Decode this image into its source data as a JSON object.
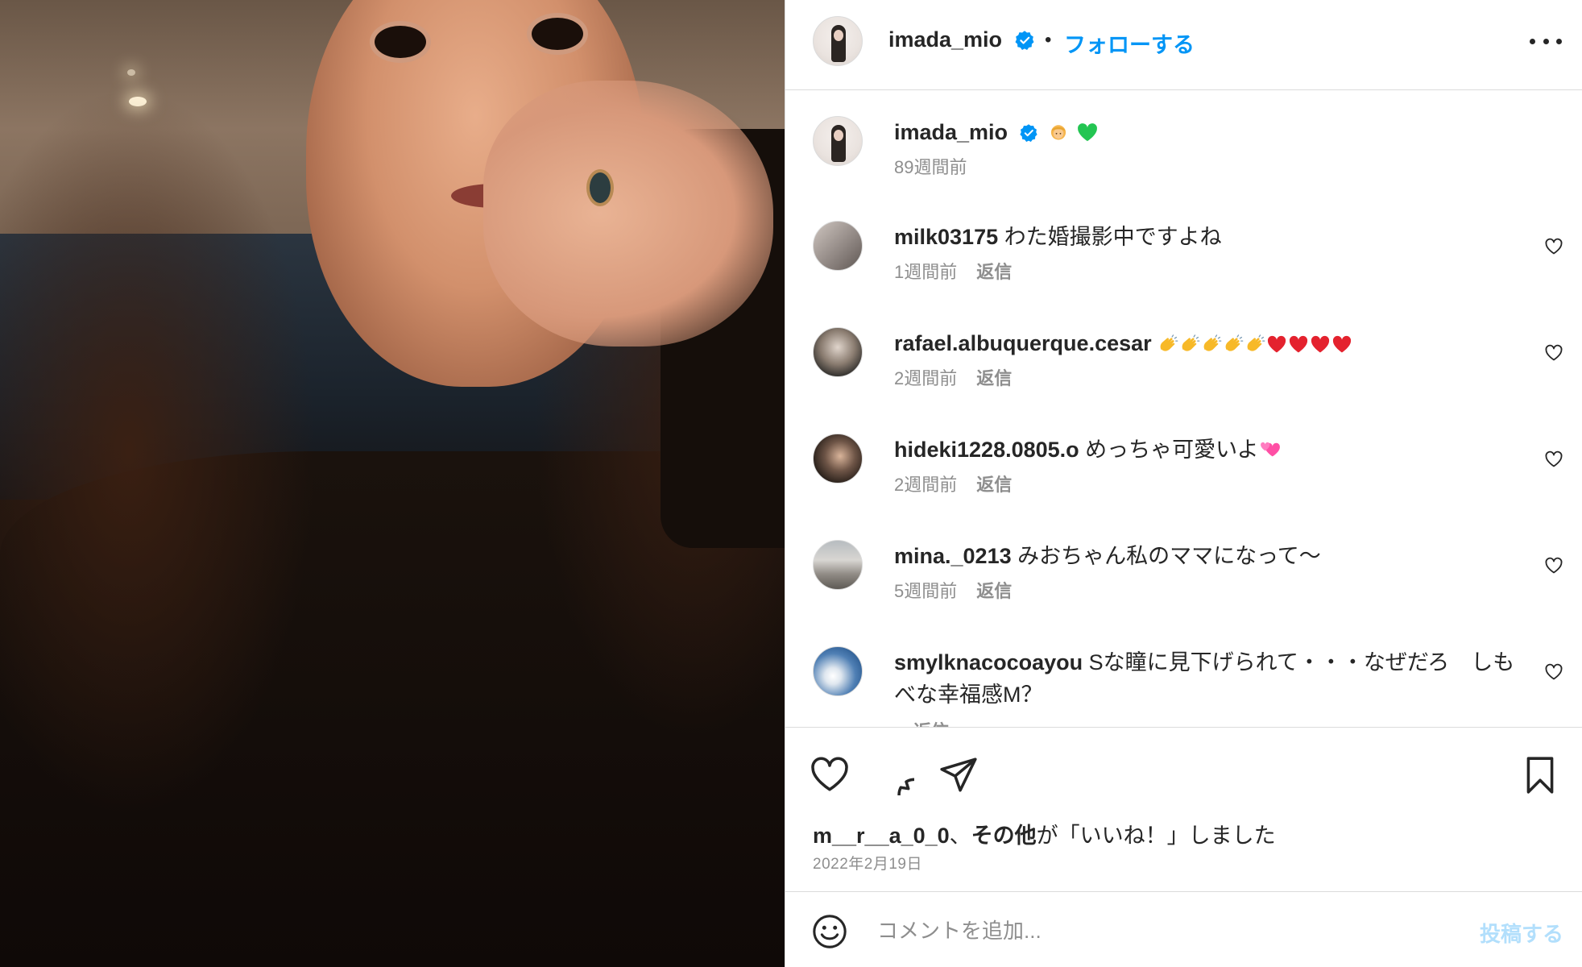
{
  "post": {
    "owner_username": "imada_mio",
    "follow_label": "フォローする",
    "separator": "•",
    "caption_emoji": [
      "person-blond-emoji",
      "green-heart-emoji"
    ],
    "caption_time": "89週間前"
  },
  "comments": [
    {
      "username": "milk03175",
      "text": "わた婚撮影中ですよね",
      "time": "1週間前",
      "reply_label": "返信"
    },
    {
      "username": "rafael.albuquerque.cesar",
      "text": "",
      "emoji": [
        "clapping-hands",
        "clapping-hands",
        "clapping-hands",
        "clapping-hands",
        "clapping-hands",
        "red-heart",
        "red-heart",
        "red-heart",
        "red-heart"
      ],
      "time": "2週間前",
      "reply_label": "返信"
    },
    {
      "username": "hideki1228.0805.o",
      "text": "めっちゃ可愛いよ",
      "emoji": [
        "two-hearts"
      ],
      "time": "2週間前",
      "reply_label": "返信"
    },
    {
      "username": "mina._0213",
      "text": "みおちゃん私のママになって〜",
      "time": "5週間前",
      "reply_label": "返信"
    },
    {
      "username": "smylknacocoayou",
      "text": "Sな瞳に見下げられて・・・なぜだろ　しもべな幸福感M？",
      "time": "",
      "reply_label": "返信"
    }
  ],
  "likes": {
    "user": "m__r__a_0_0",
    "sep": "、",
    "others": "その他",
    "suffix": "が「いいね！」しました"
  },
  "date": "2022年2月19日",
  "composer": {
    "placeholder": "コメントを追加...",
    "post_label": "投稿する"
  },
  "icons": {
    "more": "more-horizontal-icon",
    "like": "heart-outline-icon",
    "comment": "comment-icon",
    "share": "paper-plane-icon",
    "save": "bookmark-icon",
    "emoji": "smiley-icon",
    "verified": "verified-badge-icon"
  },
  "colors": {
    "accent": "#0095f6",
    "muted": "#8e8e8e",
    "text": "#262626",
    "border": "#dbdbdb",
    "post_disabled": "#b2dffc"
  }
}
